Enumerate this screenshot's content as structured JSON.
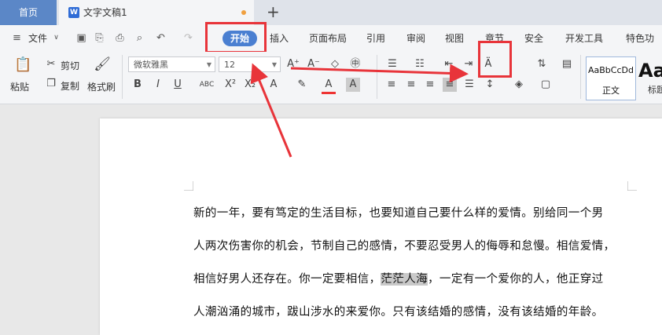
{
  "tabs": {
    "home": "首页",
    "document": "文字文稿1",
    "new_tab": "+"
  },
  "menu": {
    "file": "文件",
    "items": [
      "开始",
      "插入",
      "页面布局",
      "引用",
      "审阅",
      "视图",
      "章节",
      "安全",
      "开发工具",
      "特色功能"
    ]
  },
  "ribbon": {
    "paste": "粘贴",
    "cut": "剪切",
    "copy": "复制",
    "format_painter": "格式刷",
    "font_name": "微软雅黑",
    "font_size": "12",
    "style_normal_preview": "AaBbCcDd",
    "style_normal": "正文",
    "style_heading_preview": "Aa",
    "style_heading": "标题"
  },
  "document": {
    "lines": [
      "新的一年，要有笃定的生活目标，也要知道自己要什么样的爱情。别给同一个男",
      "人两次伤害你的机会，节制自己的感情，不要忍受男人的侮辱和怠慢。相信爱情，",
      "一定有一个爱你的人，他正穿过",
      "人潮汹涌的城市，跋山涉水的来爱你。只有该结婚的感情，没有该结婚的年龄。"
    ],
    "line3_before": "相信好男人还存在。你一定要相信，",
    "line3_highlight": "茫茫人海",
    "line3_after": "，一定有一个爱你的人，他正穿过"
  },
  "colors": {
    "accent": "#4a7fd1",
    "annotation": "#e8343a",
    "home_tab": "#5b87c7"
  }
}
